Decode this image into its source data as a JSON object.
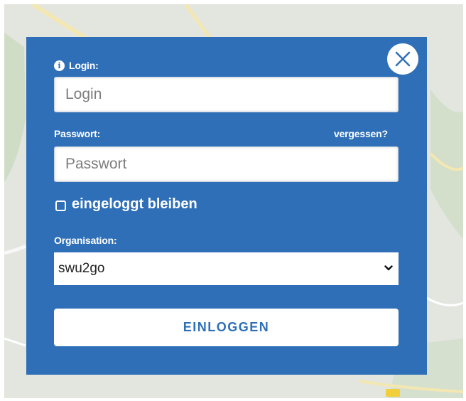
{
  "app": {
    "close_icon": "close-icon",
    "info_icon": "info-icon",
    "accent_color": "#2e6fb8"
  },
  "form": {
    "login_label": "Login:",
    "login_placeholder": "Login",
    "login_value": "",
    "password_label": "Passwort:",
    "forgot_link": "vergessen?",
    "password_placeholder": "Passwort",
    "password_value": "",
    "remember_label": "eingeloggt bleiben",
    "remember_checked": false,
    "organisation_label": "Organisation:",
    "organisation_selected": "swu2go",
    "submit_label": "EINLOGGEN"
  }
}
